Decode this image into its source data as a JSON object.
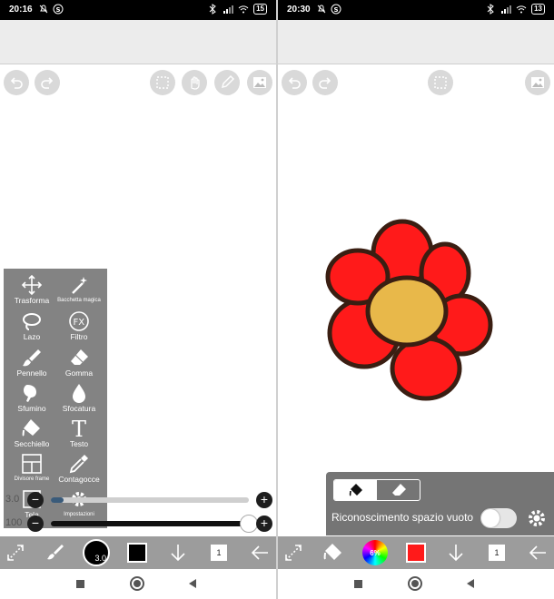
{
  "left": {
    "status": {
      "time": "20:16",
      "battery": "15"
    },
    "tools": [
      {
        "key": "transform",
        "label": "Trasforma",
        "icon": "move-arrows-icon"
      },
      {
        "key": "magic-wand",
        "label": "Bacchetta magica",
        "icon": "magic-wand-icon"
      },
      {
        "key": "lasso",
        "label": "Lazo",
        "icon": "lasso-icon"
      },
      {
        "key": "filter",
        "label": "Filtro",
        "icon": "fx-icon"
      },
      {
        "key": "pen",
        "label": "Pennello",
        "icon": "brush-icon"
      },
      {
        "key": "eraser",
        "label": "Gomma",
        "icon": "eraser-icon"
      },
      {
        "key": "smudge",
        "label": "Sfumino",
        "icon": "smudge-icon"
      },
      {
        "key": "blur",
        "label": "Sfocatura",
        "icon": "drop-icon"
      },
      {
        "key": "bucket",
        "label": "Secchiello",
        "icon": "bucket-icon"
      },
      {
        "key": "text",
        "label": "Testo",
        "icon": "text-icon"
      },
      {
        "key": "frame-divider",
        "label": "Divisore frame",
        "icon": "frame-icon"
      },
      {
        "key": "eyedropper",
        "label": "Contagocce",
        "icon": "eyedropper-icon"
      },
      {
        "key": "canvas",
        "label": "Tela",
        "icon": "canvas-icon"
      },
      {
        "key": "settings",
        "label": "Impostazioni",
        "icon": "gear-icon"
      }
    ],
    "brush_size": {
      "value": "3.0",
      "level": 0.04
    },
    "opacity": {
      "value": "100",
      "level": 1.0
    },
    "brush_indicator": "3.0",
    "current_color": "#000000",
    "layer_number": "1"
  },
  "right": {
    "status": {
      "time": "20:30",
      "battery": "13"
    },
    "fill_panel": {
      "gap_label": "Riconoscimento spazio vuoto",
      "toggle_on": false
    },
    "hue_percent": "6%",
    "current_color": "#ff1a1a",
    "layer_number": "1"
  },
  "colors": {
    "toolbar": "#9c9c9c",
    "panel": "#787878",
    "flower_petal": "#ff1a1a",
    "flower_center": "#e8b84a",
    "outline": "#3a1e12"
  }
}
